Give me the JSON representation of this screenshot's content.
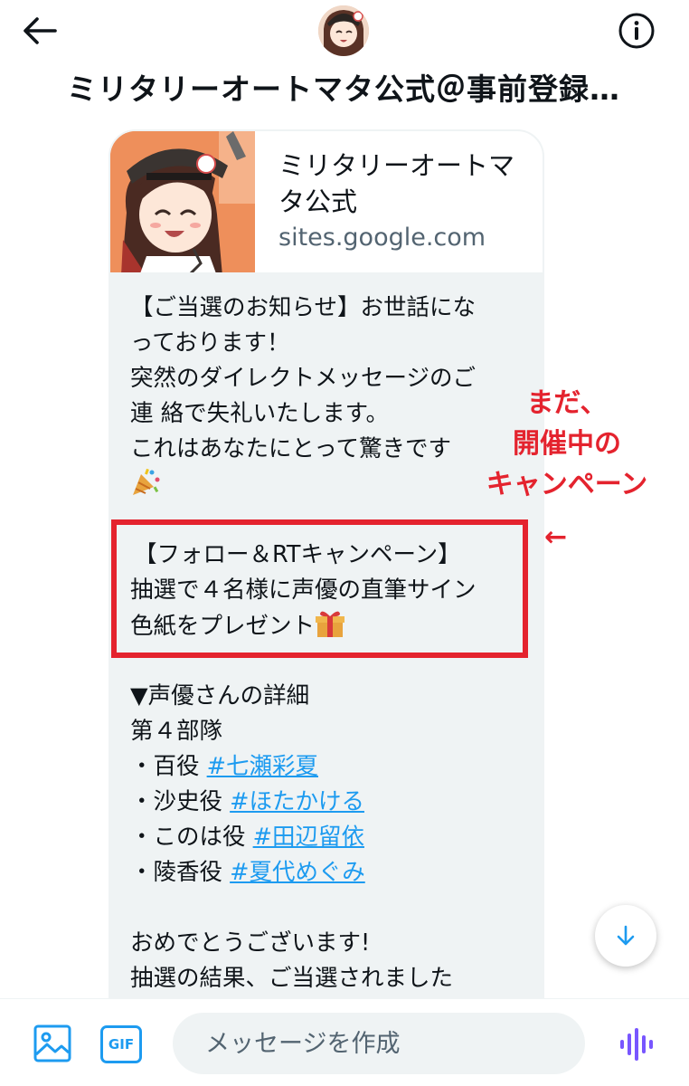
{
  "header": {
    "title": "ミリタリーオートマタ公式＠事前登録…"
  },
  "card": {
    "title_line1": "ミリタリーオートマ",
    "title_line2": "タ公式",
    "domain": "sites.google.com"
  },
  "message": {
    "intro": [
      "【ご当選のお知らせ】お世話にな",
      "っております！",
      "突然のダイレクトメッセージのご",
      "連 絡で失礼いたします。",
      "これはあなたにとって驚きです"
    ],
    "campaign": [
      "【フォロー＆RTキャンペーン】",
      "抽選で４名様に声優の直筆サイン",
      "色紙をプレゼント"
    ],
    "details_heading": "▼声優さんの詳細",
    "unit": "第４部隊",
    "roles": [
      {
        "role": "・百役 ",
        "tag": "#七瀬彩夏"
      },
      {
        "role": "・沙史役 ",
        "tag": "#ほたかける"
      },
      {
        "role": "・このは役 ",
        "tag": "#田辺留依"
      },
      {
        "role": "・陵香役 ",
        "tag": "#夏代めぐみ"
      }
    ],
    "congrats": "おめでとうございます!",
    "result": "抽選の結果、ご当選されました"
  },
  "annotation": {
    "line1": "まだ、",
    "line2": "開催中の",
    "line3": "キャンペーン",
    "arrow": "←"
  },
  "composer": {
    "placeholder": "メッセージを作成",
    "gif_label": "GIF"
  },
  "colors": {
    "accent": "#1d9bf0",
    "highlight": "#e4232e",
    "bubble": "#eff3f4",
    "voice": "#7856ff"
  }
}
